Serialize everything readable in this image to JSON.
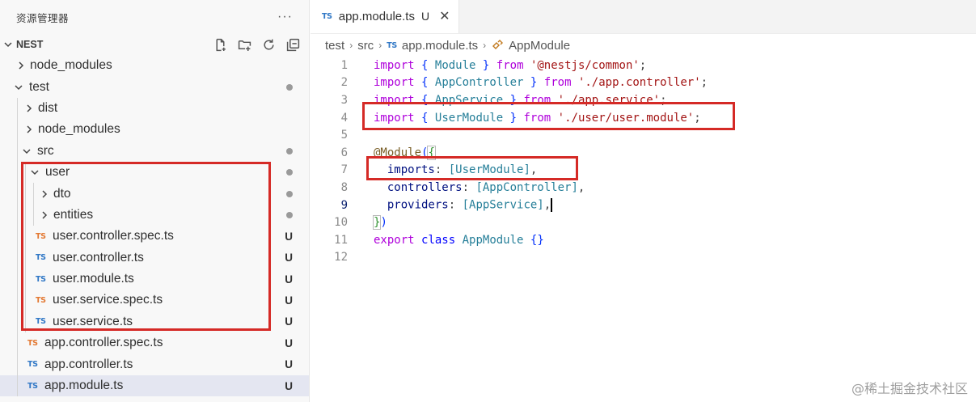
{
  "sidebar": {
    "title": "资源管理器",
    "more": "···",
    "section": "NEST",
    "rows": [
      {
        "label": "node_modules",
        "type": "folder",
        "expanded": false,
        "status": ""
      },
      {
        "label": "test",
        "type": "folder",
        "expanded": true,
        "status": "dot"
      },
      {
        "label": "dist",
        "type": "folder",
        "expanded": false,
        "status": ""
      },
      {
        "label": "node_modules",
        "type": "folder",
        "expanded": false,
        "status": ""
      },
      {
        "label": "src",
        "type": "folder",
        "expanded": true,
        "status": "dot"
      },
      {
        "label": "user",
        "type": "folder",
        "expanded": true,
        "status": "dot"
      },
      {
        "label": "dto",
        "type": "folder",
        "expanded": false,
        "status": "dot"
      },
      {
        "label": "entities",
        "type": "folder",
        "expanded": false,
        "status": "dot"
      },
      {
        "label": "user.controller.spec.ts",
        "type": "ts-spec",
        "status": "U"
      },
      {
        "label": "user.controller.ts",
        "type": "ts",
        "status": "U"
      },
      {
        "label": "user.module.ts",
        "type": "ts",
        "status": "U"
      },
      {
        "label": "user.service.spec.ts",
        "type": "ts-spec",
        "status": "U"
      },
      {
        "label": "user.service.ts",
        "type": "ts",
        "status": "U"
      },
      {
        "label": "app.controller.spec.ts",
        "type": "ts-spec",
        "status": "U"
      },
      {
        "label": "app.controller.ts",
        "type": "ts",
        "status": "U"
      },
      {
        "label": "app.module.ts",
        "type": "ts",
        "status": "U",
        "selected": true
      }
    ]
  },
  "editor": {
    "tab": {
      "badge": "TS",
      "label": "app.module.ts",
      "modified": "U",
      "close": "✕"
    },
    "breadcrumb": [
      "test",
      "src",
      "app.module.ts",
      "AppModule"
    ],
    "breadcrumb_badge": "TS",
    "line_numbers": [
      "1",
      "2",
      "3",
      "4",
      "5",
      "6",
      "7",
      "8",
      "9",
      "10",
      "11",
      "12"
    ],
    "active_line": "9",
    "code": {
      "l1": {
        "kw": "import",
        "o": "{",
        "name": "Module",
        "c": "}",
        "from": "from",
        "path": "'@nestjs/common'",
        "end": ";"
      },
      "l2": {
        "kw": "import",
        "o": "{",
        "name": "AppController",
        "c": "}",
        "from": "from",
        "path": "'./app.controller'",
        "end": ";"
      },
      "l3": {
        "kw": "import",
        "o": "{",
        "name": "AppService",
        "c": "}",
        "from": "from",
        "path": "'./app.service'",
        "end": ";"
      },
      "l4": {
        "kw": "import",
        "o": "{",
        "name": "UserModule",
        "c": "}",
        "from": "from",
        "path": "'./user/user.module'",
        "end": ";"
      },
      "l6": {
        "dec": "@Module",
        "open": "(",
        "brace": "{"
      },
      "l7": {
        "prop": "imports",
        "colon": ":",
        "arr": "[UserModule]",
        "comma": ","
      },
      "l8": {
        "prop": "controllers",
        "colon": ":",
        "arr": "[AppController]",
        "comma": ","
      },
      "l9": {
        "prop": "providers",
        "colon": ":",
        "arr": "[AppService]",
        "comma": ","
      },
      "l10": {
        "brace": "}",
        "close": ")"
      },
      "l11": {
        "kw": "export",
        "kw2": "class",
        "name": "AppModule",
        "body": "{}"
      }
    }
  },
  "watermark": "@稀土掘金技术社区",
  "colors": {
    "highlight": "#d52a26",
    "ts_blue": "#3178c6",
    "ts_orange": "#e37933",
    "selected_row": "#e4e6f1"
  }
}
